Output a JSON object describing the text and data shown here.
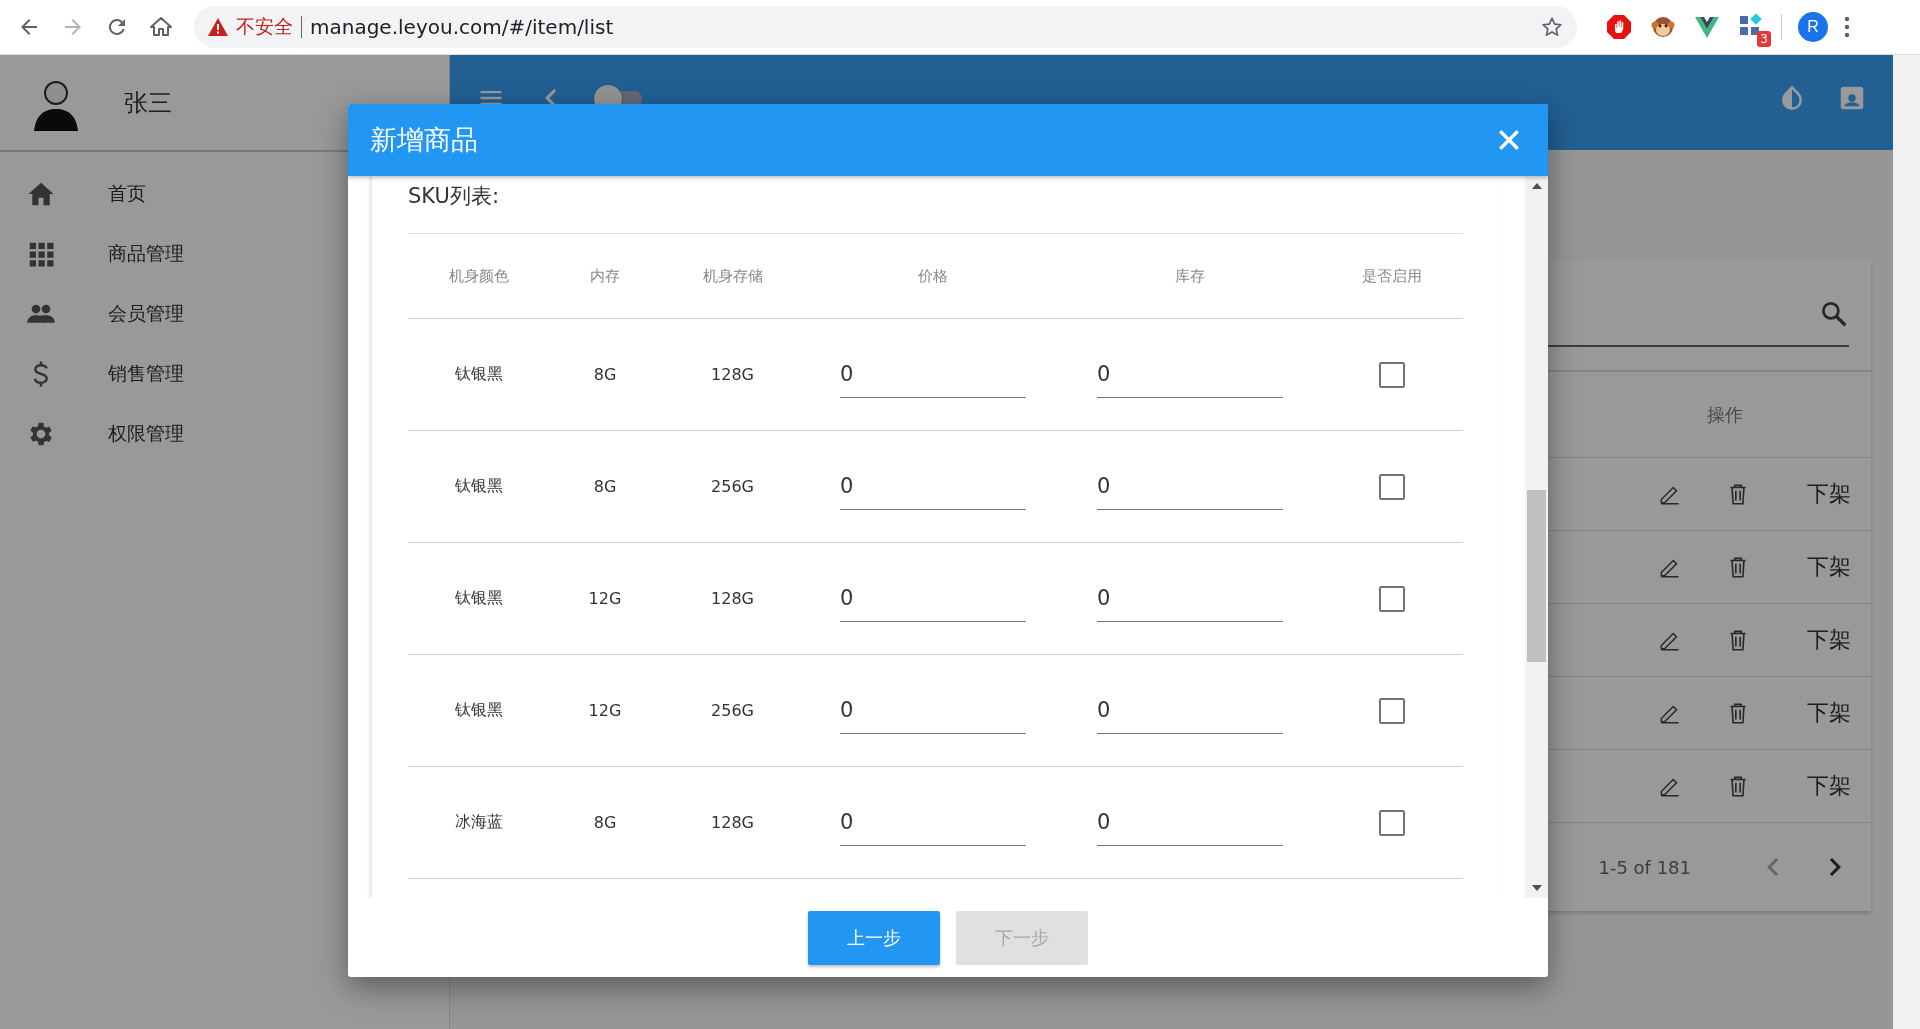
{
  "browser": {
    "url": "manage.leyou.com/#/item/list",
    "security": "不安全",
    "extension_badge": "3",
    "profile": "R"
  },
  "sidebar": {
    "user": "张三",
    "items": [
      {
        "label": "首页"
      },
      {
        "label": "商品管理"
      },
      {
        "label": "会员管理"
      },
      {
        "label": "销售管理"
      },
      {
        "label": "权限管理"
      }
    ]
  },
  "header": {
    "theme_on": false
  },
  "list": {
    "actions_heading": "操作",
    "rows": [
      {
        "action": "下架"
      },
      {
        "action": "下架"
      },
      {
        "action": "下架"
      },
      {
        "action": "下架"
      },
      {
        "action": "下架"
      }
    ],
    "pagination": "1-5 of 181"
  },
  "dialog": {
    "title": "新增商品",
    "section_label": "SKU列表:",
    "columns": [
      "机身颜色",
      "内存",
      "机身存储",
      "价格",
      "库存",
      "是否启用"
    ],
    "rows": [
      {
        "cells": [
          "钛银黑",
          "8G",
          "128G"
        ],
        "price": "0",
        "stock": "0",
        "enabled": false
      },
      {
        "cells": [
          "钛银黑",
          "8G",
          "256G"
        ],
        "price": "0",
        "stock": "0",
        "enabled": false
      },
      {
        "cells": [
          "钛银黑",
          "12G",
          "128G"
        ],
        "price": "0",
        "stock": "0",
        "enabled": false
      },
      {
        "cells": [
          "钛银黑",
          "12G",
          "256G"
        ],
        "price": "0",
        "stock": "0",
        "enabled": false
      },
      {
        "cells": [
          "冰海蓝",
          "8G",
          "128G"
        ],
        "price": "0",
        "stock": "0",
        "enabled": false
      }
    ],
    "buttons": [
      {
        "label": "上一步",
        "disabled": false
      },
      {
        "label": "下一步",
        "disabled": true
      }
    ]
  }
}
